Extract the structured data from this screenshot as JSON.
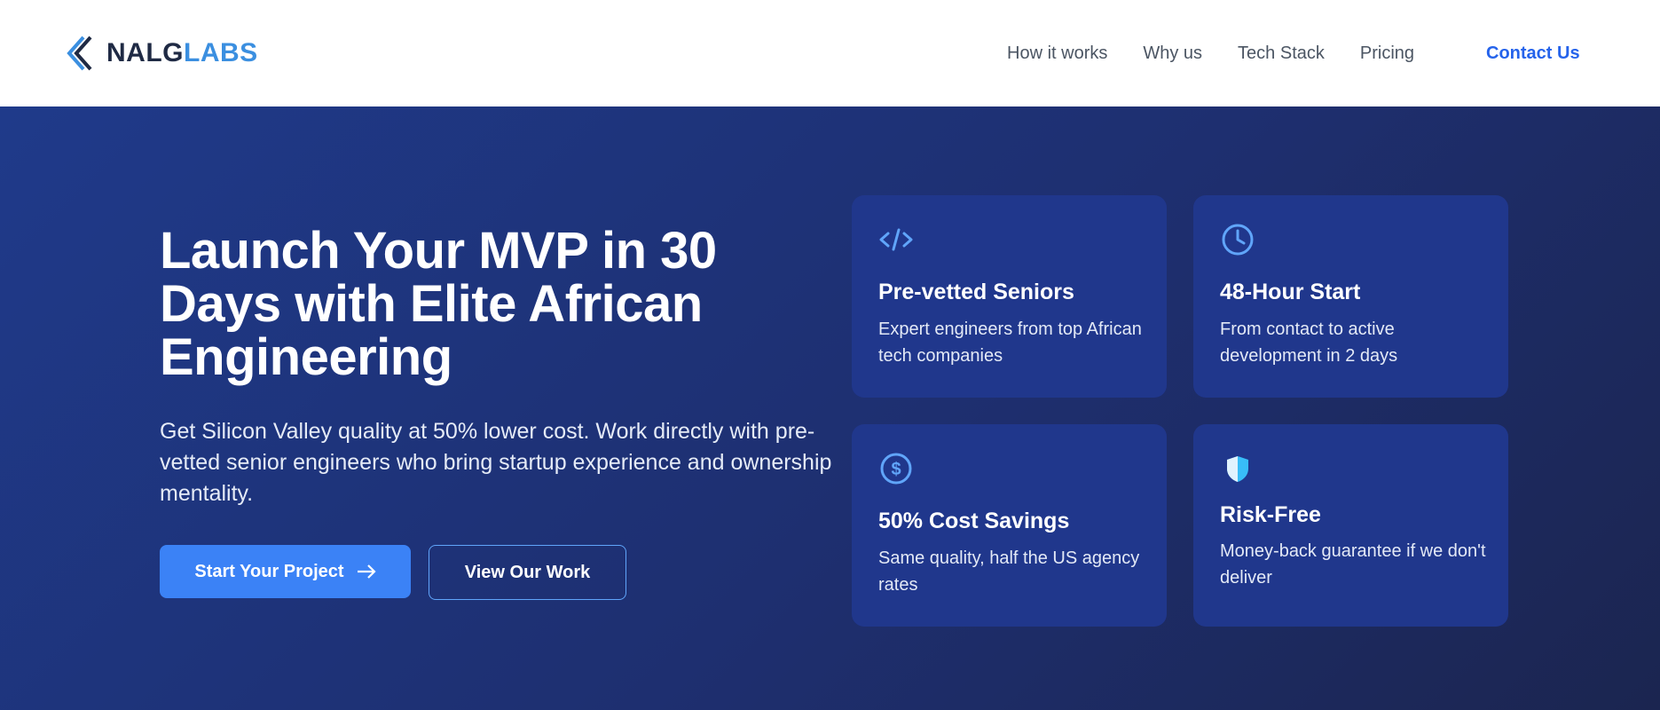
{
  "brand": {
    "name_part1": "NALG",
    "name_part2": "LABS",
    "accent": "#3b8fe0",
    "dark": "#1f2a44"
  },
  "nav": {
    "items": [
      "How it works",
      "Why us",
      "Tech Stack",
      "Pricing"
    ],
    "contact_label": "Contact Us"
  },
  "hero": {
    "title": "Launch Your MVP in 30 Days with Elite African Engineering",
    "subtitle": "Get Silicon Valley quality at 50% lower cost. Work directly with pre-vetted senior engineers who bring startup experience and ownership mentality.",
    "primary_button": "Start Your Project",
    "secondary_button": "View Our Work"
  },
  "features": [
    {
      "icon": "code-icon",
      "title": "Pre-vetted Seniors",
      "desc": "Expert engineers from top African tech companies"
    },
    {
      "icon": "clock-icon",
      "title": "48-Hour Start",
      "desc": "From contact to active development in 2 days"
    },
    {
      "icon": "dollar-icon",
      "title": "50% Cost Savings",
      "desc": "Same quality, half the US agency rates"
    },
    {
      "icon": "shield-icon",
      "title": "Risk-Free",
      "desc": "Money-back guarantee if we don't deliver"
    }
  ],
  "colors": {
    "hero_bg_start": "#1f3a8a",
    "hero_bg_end": "#1b2550",
    "primary_button": "#3b82f6",
    "icon_blue": "#60a5fa"
  }
}
